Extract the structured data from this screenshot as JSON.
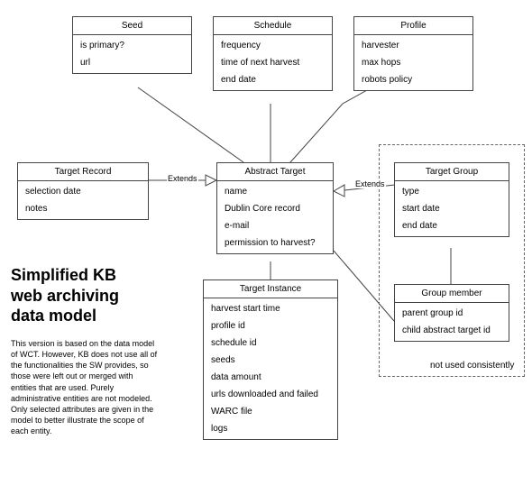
{
  "headline_line1": "Simplified KB",
  "headline_line2": "web archiving",
  "headline_line3": "data model",
  "blurb": "This version is based on the data model of WCT. However, KB does not use all of the functionalities the SW provides, so those were left out or merged with entities that are used. Purely administrative entities are not modeled. Only selected attributes are given in the model to better illustrate the scope of each entity.",
  "dash_label": "not used consistently",
  "extends_left": "Extends",
  "extends_right": "Extends",
  "entities": {
    "seed": {
      "title": "Seed",
      "attrs": [
        "is primary?",
        "url"
      ]
    },
    "schedule": {
      "title": "Schedule",
      "attrs": [
        "frequency",
        "time of next harvest",
        "end date"
      ]
    },
    "profile": {
      "title": "Profile",
      "attrs": [
        "harvester",
        "max hops",
        "robots policy"
      ]
    },
    "target_record": {
      "title": "Target Record",
      "attrs": [
        "selection date",
        "notes"
      ]
    },
    "abstract_target": {
      "title": "Abstract Target",
      "attrs": [
        "name",
        "Dublin Core record",
        "e-mail",
        "permission to harvest?"
      ]
    },
    "target_group": {
      "title": "Target Group",
      "attrs": [
        "type",
        "start date",
        "end date"
      ]
    },
    "target_instance": {
      "title": "Target Instance",
      "attrs": [
        "harvest start time",
        "profile id",
        "schedule id",
        "seeds",
        "data amount",
        "urls downloaded and failed",
        "WARC file",
        "logs"
      ]
    },
    "group_member": {
      "title": "Group member",
      "attrs": [
        "parent group id",
        "child abstract target id"
      ]
    }
  }
}
